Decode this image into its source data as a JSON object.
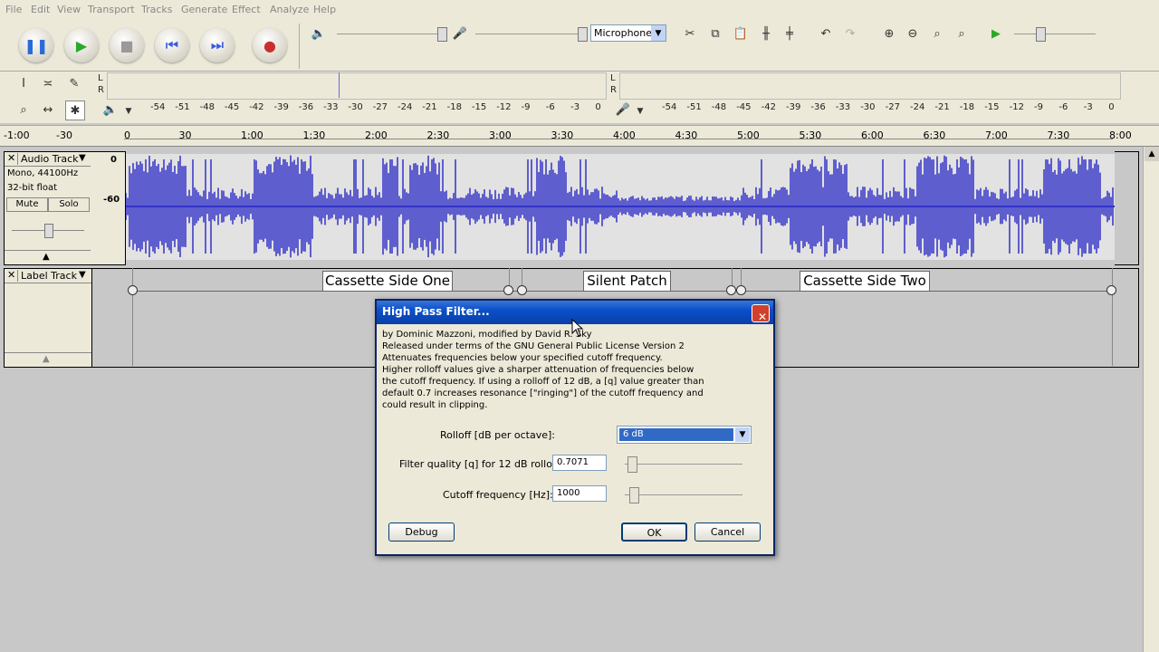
{
  "menu": [
    "File",
    "Edit",
    "View",
    "Transport",
    "Tracks",
    "Generate",
    "Effect",
    "Analyze",
    "Help"
  ],
  "toolbar": {
    "transport": [
      {
        "name": "pause",
        "glyph": "❚❚",
        "color": "#2a6ad8"
      },
      {
        "name": "play",
        "glyph": "▶",
        "color": "#2aa82a"
      },
      {
        "name": "stop",
        "glyph": "■",
        "color": "#999999"
      },
      {
        "name": "skip-start",
        "glyph": "⏮",
        "color": "#3a5ad8"
      },
      {
        "name": "skip-end",
        "glyph": "⏭",
        "color": "#3a5ad8"
      },
      {
        "name": "record",
        "glyph": "●",
        "color": "#c83030"
      }
    ],
    "input_source": "Microphone",
    "meter_left_lr": [
      "L",
      "R"
    ],
    "meter_right_lr": [
      "L",
      "R"
    ],
    "meter_ticks": [
      "-54",
      "-51",
      "-48",
      "-45",
      "-42",
      "-39",
      "-36",
      "-33",
      "-30",
      "-27",
      "-24",
      "-21",
      "-18",
      "-15",
      "-12",
      "-9",
      "-6",
      "-3",
      "0"
    ]
  },
  "ruler": {
    "pre": [
      "-1:00",
      "-30"
    ],
    "labels": [
      "0",
      "30",
      "1:00",
      "1:30",
      "2:00",
      "2:30",
      "3:00",
      "3:30",
      "4:00",
      "4:30",
      "5:00",
      "5:30",
      "6:00",
      "6:30",
      "7:00",
      "7:30",
      "8:00"
    ]
  },
  "audio_track": {
    "name": "Audio Track",
    "format": "Mono, 44100Hz",
    "depth": "32-bit float",
    "mute": "Mute",
    "solo": "Solo",
    "scale_top": "0",
    "scale_mid": "-60",
    "color": "#3232c8"
  },
  "label_track": {
    "name": "Label Track",
    "labels": [
      "Cassette Side One",
      "Silent Patch",
      "Cassette Side Two"
    ]
  },
  "dialog": {
    "title": "High Pass Filter...",
    "close": "✕",
    "description": [
      "by Dominic Mazzoni, modified by David R. Sky",
      "Released under terms of the GNU General Public License Version 2",
      "Attenuates frequencies below your specified cutoff frequency.",
      "Higher rolloff values give a sharper attenuation of frequencies below",
      "the cutoff frequency. If using a rolloff of 12 dB, a [q] value greater than",
      "default 0.7 increases resonance [\"ringing\"] of the cutoff frequency and",
      "could result in clipping."
    ],
    "rolloff_label": "Rolloff [dB per octave]:",
    "rolloff_value": "6 dB",
    "q_label": "Filter quality [q] for 12 dB rolloff:",
    "q_value": "0.7071",
    "cutoff_label": "Cutoff frequency [Hz]:",
    "cutoff_value": "1000",
    "debug": "Debug",
    "ok": "OK",
    "cancel": "Cancel"
  }
}
